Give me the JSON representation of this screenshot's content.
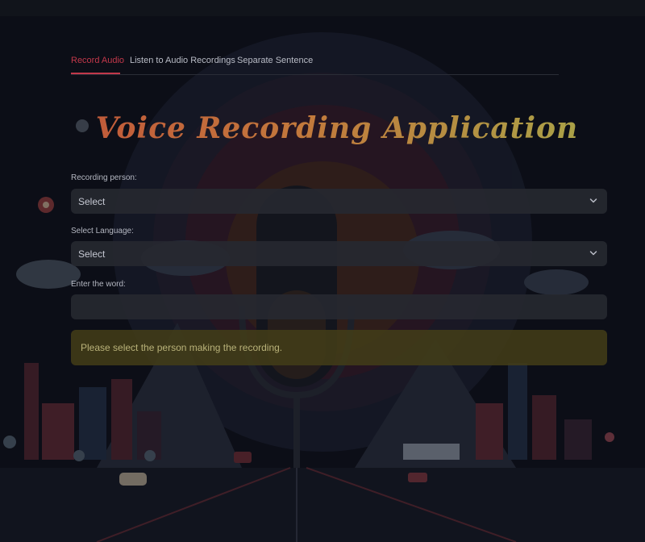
{
  "tabs": [
    {
      "label": "Record Audio",
      "active": true
    },
    {
      "label": "Listen to Audio Recordings",
      "active": false
    },
    {
      "label": "Separate Sentence",
      "active": false
    }
  ],
  "app_title": "Voice Recording Application",
  "form": {
    "recording_person": {
      "label": "Recording person:",
      "value": "Select"
    },
    "language": {
      "label": "Select Language:",
      "value": "Select"
    },
    "word": {
      "label": "Enter the word:",
      "value": ""
    }
  },
  "alert": {
    "message": "Please select the person making the recording."
  },
  "colors": {
    "accent": "#c2384a",
    "background": "#0c0e17",
    "input_background": "#262830",
    "warning_background": "#423c18",
    "warning_text": "#b9b279"
  },
  "icons": {
    "select_chevron": "chevron-down-icon"
  }
}
